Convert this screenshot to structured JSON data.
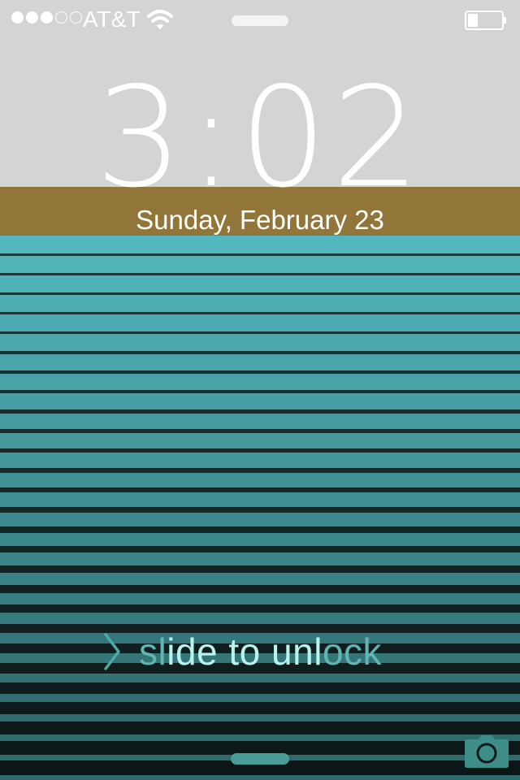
{
  "status_bar": {
    "signal_bars_filled": 3,
    "signal_bars_total": 5,
    "carrier": "AT&T",
    "wifi_icon": "wifi-icon",
    "battery_level": 0.3
  },
  "lock_screen": {
    "time": "3:02",
    "date": "Sunday, February 23",
    "slide_prefix": "sl",
    "slide_highlight": "ide to unl",
    "slide_suffix": "ock"
  },
  "icons": {
    "chevron": "chevron-right-icon",
    "camera": "camera-icon"
  },
  "colors": {
    "sky": "#d3d4d3",
    "gold_band": "#927538",
    "teal": "#52b8bd",
    "dark": "#101a1a",
    "unlock_text": "#61b6b3",
    "unlock_highlight": "#b8f3ee"
  }
}
